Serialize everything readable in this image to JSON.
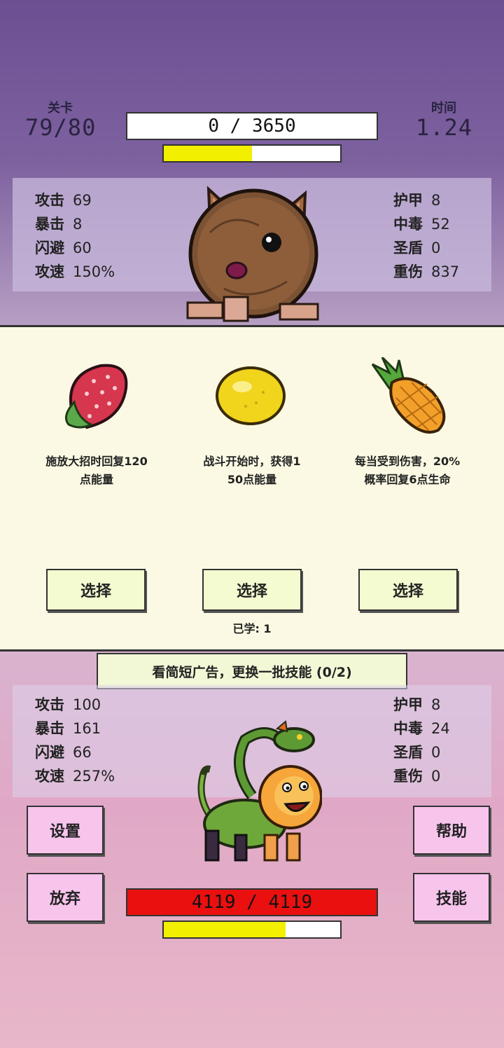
{
  "header": {
    "level_label": "关卡",
    "level_value": "79/80",
    "time_label": "时间",
    "time_value": "1.24",
    "enemy_hp": "0 / 3650",
    "enemy_energy_fraction": 0.5
  },
  "enemy_stats": {
    "left": [
      {
        "label": "攻击",
        "value": "69"
      },
      {
        "label": "暴击",
        "value": "8"
      },
      {
        "label": "闪避",
        "value": "60"
      },
      {
        "label": "攻速",
        "value": "150%"
      }
    ],
    "right": [
      {
        "label": "护甲",
        "value": "8"
      },
      {
        "label": "中毒",
        "value": "52"
      },
      {
        "label": "圣盾",
        "value": "0"
      },
      {
        "label": "重伤",
        "value": "837"
      }
    ]
  },
  "skills": [
    {
      "icon": "strawberry-icon",
      "desc_line1": "施放大招时回复120",
      "desc_line2": "点能量",
      "button": "选择"
    },
    {
      "icon": "lemon-icon",
      "desc_line1": "战斗开始时，获得1",
      "desc_line2": "50点能量",
      "button": "选择"
    },
    {
      "icon": "pineapple-icon",
      "desc_line1": "每当受到伤害，20%",
      "desc_line2": "概率回复6点生命",
      "button": "选择"
    }
  ],
  "learned": "已学: 1",
  "ad_button": "看简短广告，更换一批技能 (0/2)",
  "player_stats": {
    "left": [
      {
        "label": "攻击",
        "value": "100"
      },
      {
        "label": "暴击",
        "value": "161"
      },
      {
        "label": "闪避",
        "value": "66"
      },
      {
        "label": "攻速",
        "value": "257%"
      }
    ],
    "right": [
      {
        "label": "护甲",
        "value": "8"
      },
      {
        "label": "中毒",
        "value": "24"
      },
      {
        "label": "圣盾",
        "value": "0"
      },
      {
        "label": "重伤",
        "value": "0"
      }
    ]
  },
  "buttons": {
    "settings": "设置",
    "help": "帮助",
    "give_up": "放弃",
    "skills": "技能"
  },
  "player": {
    "hp": "4119 / 4119",
    "energy_fraction": 0.69
  },
  "colors": {
    "hp_red": "#ea1010",
    "energy_yellow": "#f2f000",
    "pink_button": "#f7c4ec",
    "card_bg": "#fbf9e3"
  }
}
